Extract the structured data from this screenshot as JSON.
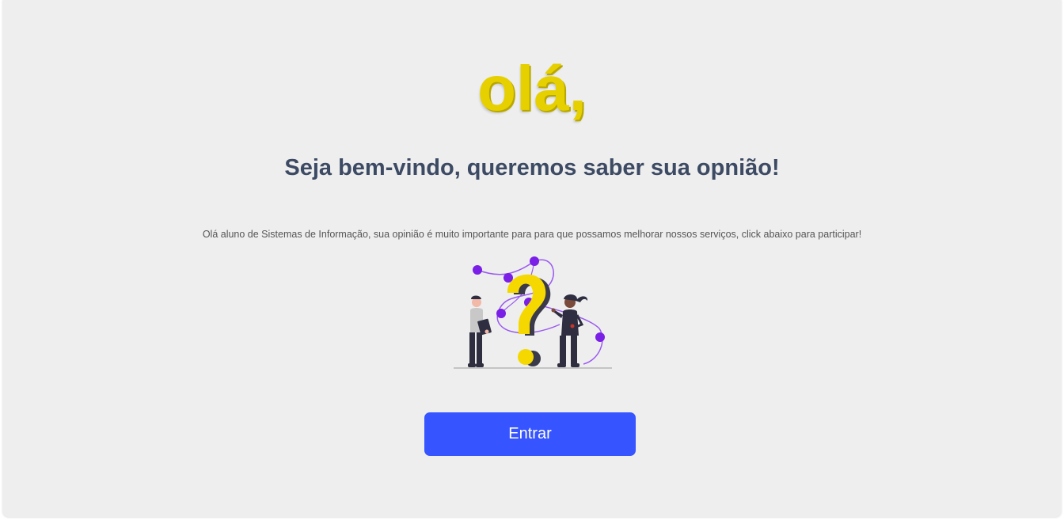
{
  "greeting": "olá,",
  "subtitle": "Seja bem-vindo, queremos saber sua opnião!",
  "description": "Olá aluno de Sistemas de Informação, sua opinião é muito importante para para que possamos melhorar nossos serviços, click abaixo para participar!",
  "illustration": {
    "icon": "question-people-illustration"
  },
  "enter_button": {
    "label": "Entrar"
  },
  "colors": {
    "background": "#eeeeee",
    "greeting": "#e6d000",
    "subtitle": "#3c4a64",
    "description": "#555555",
    "button": "#3654ff",
    "accent_purple": "#7a1fe6",
    "question_mark": "#f5d800"
  }
}
